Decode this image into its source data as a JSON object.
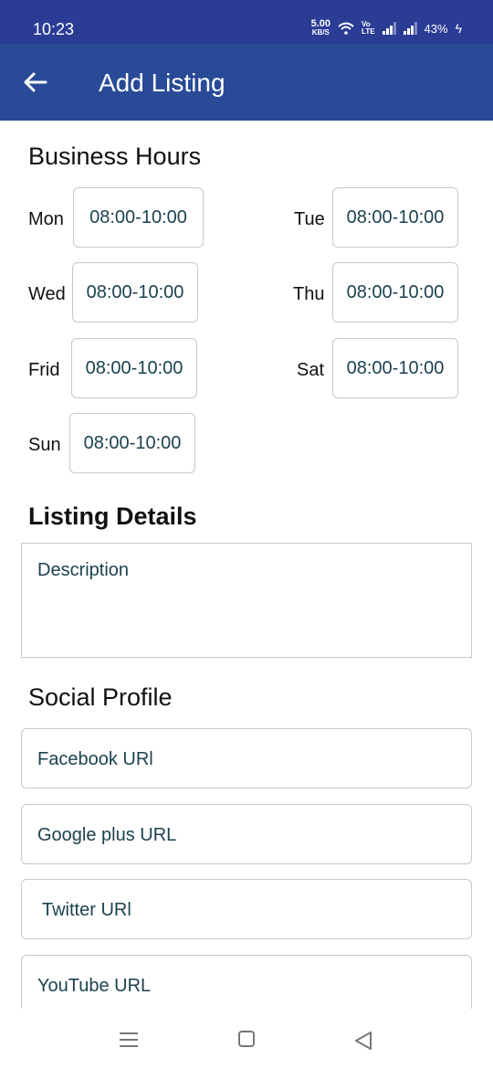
{
  "status_bar": {
    "time": "10:23",
    "net_speed": "5.00",
    "net_speed_unit": "KB/S",
    "volte_top": "Vo",
    "volte_bottom": "LTE",
    "battery": "43%",
    "color": "#2b3c95"
  },
  "app_bar": {
    "title": "Add Listing",
    "back_icon": "arrow-left-icon",
    "color": "#284a97"
  },
  "business_hours": {
    "title": "Business Hours",
    "days": [
      {
        "day": "Mon",
        "hours": "08:00-10:00"
      },
      {
        "day": "Tue",
        "hours": "08:00-10:00"
      },
      {
        "day": "Wed",
        "hours": "08:00-10:00"
      },
      {
        "day": "Thu",
        "hours": "08:00-10:00"
      },
      {
        "day": "Frid",
        "hours": "08:00-10:00"
      },
      {
        "day": "Sat",
        "hours": "08:00-10:00"
      },
      {
        "day": "Sun",
        "hours": "08:00-10:00"
      }
    ]
  },
  "listing_details": {
    "title": "Listing Details",
    "description_placeholder": "Description"
  },
  "social_profile": {
    "title": "Social Profile",
    "fields": [
      {
        "placeholder": "Facebook URl"
      },
      {
        "placeholder": "Google plus URL"
      },
      {
        "placeholder": "Twitter URl"
      },
      {
        "placeholder": "YouTube URL"
      }
    ]
  },
  "nav_bar": {
    "menu_icon": "recent-apps-icon",
    "home_icon": "home-icon",
    "back_icon": "back-triangle-icon"
  }
}
